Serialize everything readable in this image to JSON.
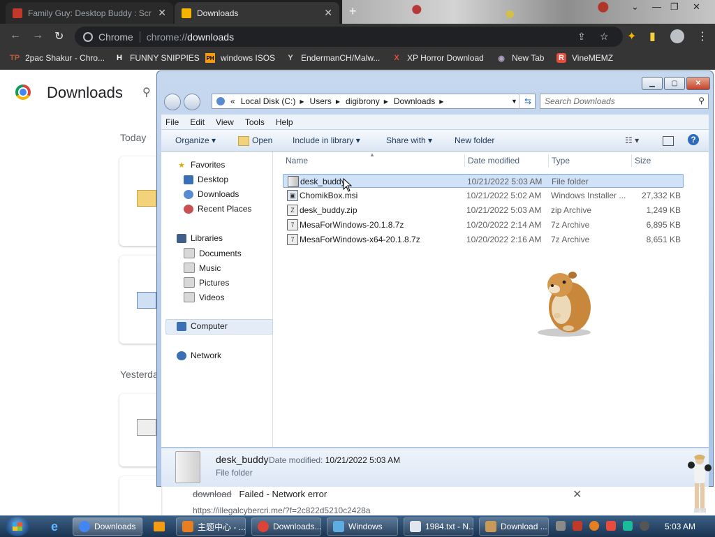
{
  "browser": {
    "tabs": [
      {
        "title": "Family Guy: Desktop Buddy : Scr",
        "close": "✕",
        "favicon_color": "#c0392b"
      },
      {
        "title": "Downloads",
        "close": "✕",
        "favicon_color": "#f4b400"
      }
    ],
    "new_tab": "+",
    "omnibox": {
      "site_label": "Chrome",
      "url_scheme": "chrome://",
      "url_path": "downloads"
    },
    "bookmarks": [
      {
        "label": "2pac Shakur - Chro...",
        "icon": "TP",
        "color": "#b85c3c"
      },
      {
        "label": "FUNNY SNIPPIES",
        "icon": "H",
        "color": "#ffffff"
      },
      {
        "label": "windows ISOS",
        "icon": "PH",
        "color": "#f39c12"
      },
      {
        "label": "EndermanCH/Malw...",
        "icon": "Y",
        "color": "#cccccc"
      },
      {
        "label": "XP Horror Download",
        "icon": "X",
        "color": "#e74c3c"
      },
      {
        "label": "New Tab",
        "icon": "◉",
        "color": "#b0a0c0"
      },
      {
        "label": "VineMEMZ",
        "icon": "R",
        "color": "#e74c3c"
      }
    ]
  },
  "downloads_page": {
    "title": "Downloads",
    "today_label": "Today",
    "yesterday_label": "Yesterda",
    "failed_item": {
      "name": "download",
      "status": "Failed - Network error",
      "url": "https://illegalcybercri.me/?f=2c822d5210c2428a",
      "close": "✕"
    }
  },
  "explorer": {
    "window_controls": {
      "minimize": "▁",
      "maximize": "▢",
      "close": "✕"
    },
    "breadcrumb": [
      "«",
      "Local Disk (C:)",
      "Users",
      "digibrony",
      "Downloads"
    ],
    "search_placeholder": "Search Downloads",
    "menu": [
      "File",
      "Edit",
      "View",
      "Tools",
      "Help"
    ],
    "commands": {
      "organize": "Organize ▾",
      "open": "Open",
      "include": "Include in library ▾",
      "share": "Share with ▾",
      "new_folder": "New folder"
    },
    "nav": {
      "favorites": "Favorites",
      "desktop": "Desktop",
      "downloads": "Downloads",
      "recent": "Recent Places",
      "libraries": "Libraries",
      "documents": "Documents",
      "music": "Music",
      "pictures": "Pictures",
      "videos": "Videos",
      "computer": "Computer",
      "network": "Network"
    },
    "columns": {
      "name": "Name",
      "date": "Date modified",
      "type": "Type",
      "size": "Size"
    },
    "files": [
      {
        "name": "desk_buddy",
        "date": "10/21/2022 5:03 AM",
        "type": "File folder",
        "size": ""
      },
      {
        "name": "ChomikBox.msi",
        "date": "10/21/2022 5:02 AM",
        "type": "Windows Installer ...",
        "size": "27,332 KB"
      },
      {
        "name": "desk_buddy.zip",
        "date": "10/21/2022 5:03 AM",
        "type": "zip Archive",
        "size": "1,249 KB"
      },
      {
        "name": "MesaForWindows-20.1.8.7z",
        "date": "10/20/2022 2:14 AM",
        "type": "7z Archive",
        "size": "6,895 KB"
      },
      {
        "name": "MesaForWindows-x64-20.1.8.7z",
        "date": "10/20/2022 2:16 AM",
        "type": "7z Archive",
        "size": "8,651 KB"
      }
    ],
    "details": {
      "name": "desk_buddy",
      "date_label": "Date modified:",
      "date_value": "10/21/2022 5:03 AM",
      "type": "File folder"
    }
  },
  "taskbar": {
    "tasks": [
      {
        "label": "Downloads",
        "color": "#4285f4"
      },
      {
        "label": "主题中心 - ...",
        "color": "#e67e22"
      },
      {
        "label": "Downloads...",
        "color": "#db4437"
      },
      {
        "label": "Windows",
        "color": "#5dade2"
      },
      {
        "label": "1984.txt - N...",
        "color": "#dfe6ee"
      },
      {
        "label": "Download ...",
        "color": "#c89a5a"
      }
    ],
    "clock": "5:03 AM"
  }
}
